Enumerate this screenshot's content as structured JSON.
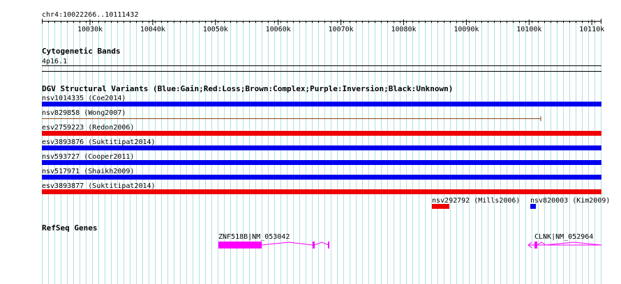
{
  "location": "chr4:10022266..10111432",
  "ruler": {
    "ticks": [
      "10030k",
      "10040k",
      "10050k",
      "10060k",
      "10070k",
      "10080k",
      "10090k",
      "10100k",
      "10110k"
    ]
  },
  "tracks": {
    "cytoband": {
      "title": "Cytogenetic Bands",
      "band": "4p16.1"
    },
    "dgv": {
      "title": "DGV Structural Variants (Blue:Gain;Red:Loss;Brown:Complex;Purple:Inversion;Black:Unknown)",
      "colors": {
        "gain": "#0000ee",
        "loss": "#ee0000",
        "complex": "#8b4513"
      },
      "variants": [
        {
          "label": "nsv1014335 (Coe2014)",
          "type": "gain"
        },
        {
          "label": "nsv829858 (Wong2007)",
          "type": "complex"
        },
        {
          "label": "esv2759223 (Redon2006)",
          "type": "loss"
        },
        {
          "label": "esv3893876 (Suktitipat2014)",
          "type": "gain"
        },
        {
          "label": "nsv593727 (Cooper2011)",
          "type": "gain"
        },
        {
          "label": "nsv517971 (Shaikh2009)",
          "type": "gain"
        },
        {
          "label": "esv3893877 (Suktitipat2014)",
          "type": "loss"
        },
        {
          "label": "nsv292792 (Mills2006)",
          "type": "loss"
        },
        {
          "label": "nsv820003 (Kim2009)",
          "type": "gain"
        }
      ]
    },
    "refseq": {
      "title": "RefSeq Genes",
      "color": "#ff00ff",
      "genes": [
        {
          "label": "ZNF518B|NM_053042"
        },
        {
          "label": "CLNK|NM_052964"
        }
      ]
    }
  },
  "colors": {
    "grid": "#b0e0e6",
    "text": "#000000"
  }
}
